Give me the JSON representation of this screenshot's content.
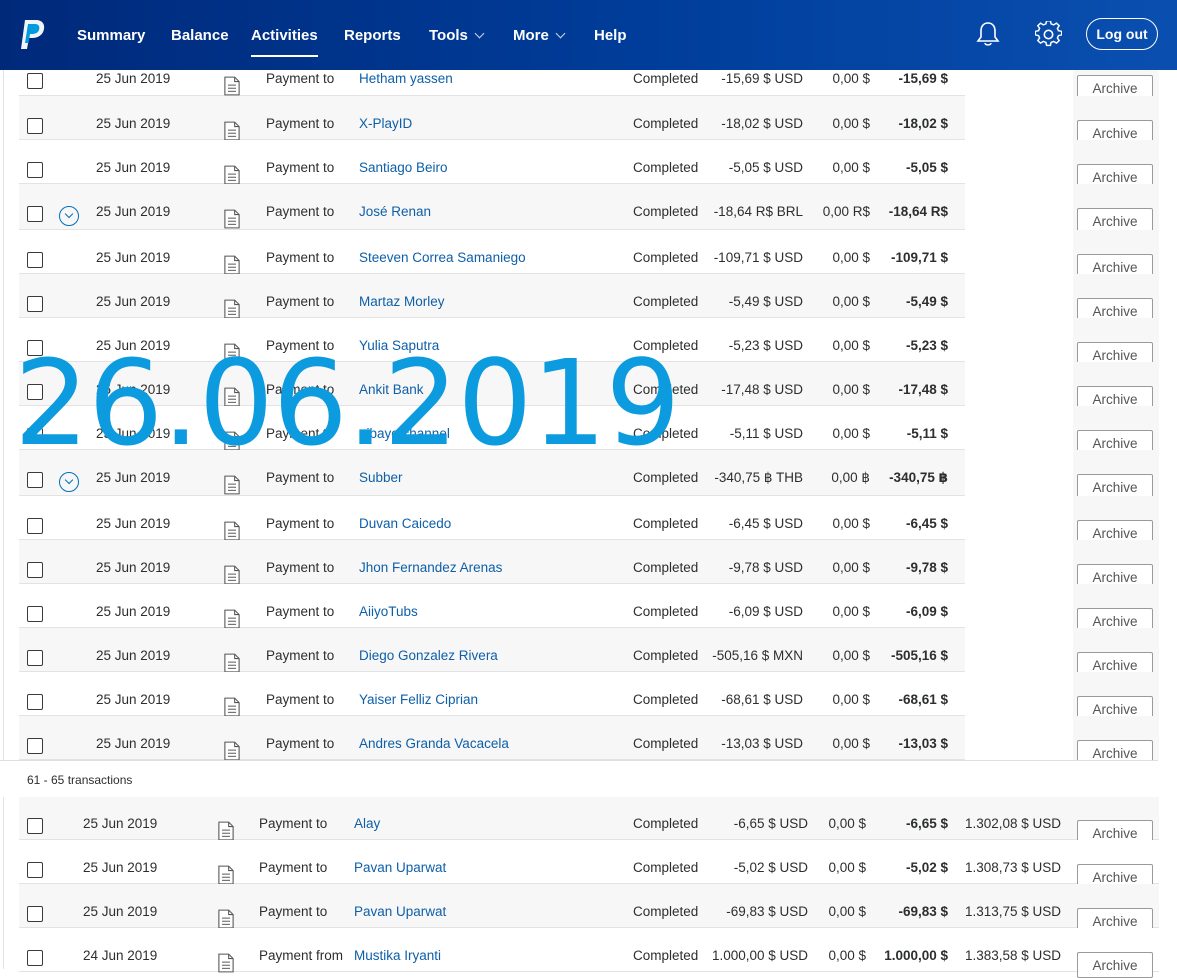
{
  "nav": {
    "items": [
      {
        "label": "Summary"
      },
      {
        "label": "Balance"
      },
      {
        "label": "Activities"
      },
      {
        "label": "Reports"
      },
      {
        "label": "Tools"
      },
      {
        "label": "More"
      },
      {
        "label": "Help"
      }
    ],
    "active": "Activities",
    "logout_label": "Log out"
  },
  "overlay_date": "26.06.2019",
  "archive_label": "Archive",
  "group_label": "61 - 65 transactions",
  "transactions_top": [
    {
      "date": "25 Jun 2019",
      "type": "Payment to",
      "name": "Hetham yassen",
      "status": "Completed",
      "gross": "-15,69 $ USD",
      "fee": "0,00 $",
      "net": "-15,69 $",
      "expandable": false
    },
    {
      "date": "25 Jun 2019",
      "type": "Payment to",
      "name": "X-PlayID",
      "status": "Completed",
      "gross": "-18,02 $ USD",
      "fee": "0,00 $",
      "net": "-18,02 $",
      "expandable": false
    },
    {
      "date": "25 Jun 2019",
      "type": "Payment to",
      "name": "Santiago Beiro",
      "status": "Completed",
      "gross": "-5,05 $ USD",
      "fee": "0,00 $",
      "net": "-5,05 $",
      "expandable": false
    },
    {
      "date": "25 Jun 2019",
      "type": "Payment to",
      "name": "José Renan",
      "status": "Completed",
      "gross": "-18,64 R$ BRL",
      "fee": "0,00 R$",
      "net": "-18,64 R$",
      "expandable": true
    },
    {
      "date": "25 Jun 2019",
      "type": "Payment to",
      "name": "Steeven Correa Samaniego",
      "status": "Completed",
      "gross": "-109,71 $ USD",
      "fee": "0,00 $",
      "net": "-109,71 $",
      "expandable": false
    },
    {
      "date": "25 Jun 2019",
      "type": "Payment to",
      "name": "Martaz Morley",
      "status": "Completed",
      "gross": "-5,49 $ USD",
      "fee": "0,00 $",
      "net": "-5,49 $",
      "expandable": false
    },
    {
      "date": "25 Jun 2019",
      "type": "Payment to",
      "name": "Yulia Saputra",
      "status": "Completed",
      "gross": "-5,23 $ USD",
      "fee": "0,00 $",
      "net": "-5,23 $",
      "expandable": false
    },
    {
      "date": "25 Jun 2019",
      "type": "Payment to",
      "name": "Ankit Bank",
      "status": "Completed",
      "gross": "-17,48 $ USD",
      "fee": "0,00 $",
      "net": "-17,48 $",
      "expandable": false
    },
    {
      "date": "25 Jun 2019",
      "type": "Payment to",
      "name": "aibaye channel",
      "status": "Completed",
      "gross": "-5,11 $ USD",
      "fee": "0,00 $",
      "net": "-5,11 $",
      "expandable": false
    },
    {
      "date": "25 Jun 2019",
      "type": "Payment to",
      "name": "Subber",
      "status": "Completed",
      "gross": "-340,75 ฿ THB",
      "fee": "0,00 ฿",
      "net": "-340,75 ฿",
      "expandable": true
    },
    {
      "date": "25 Jun 2019",
      "type": "Payment to",
      "name": "Duvan Caicedo",
      "status": "Completed",
      "gross": "-6,45 $ USD",
      "fee": "0,00 $",
      "net": "-6,45 $",
      "expandable": false
    },
    {
      "date": "25 Jun 2019",
      "type": "Payment to",
      "name": "Jhon Fernandez Arenas",
      "status": "Completed",
      "gross": "-9,78 $ USD",
      "fee": "0,00 $",
      "net": "-9,78 $",
      "expandable": false
    },
    {
      "date": "25 Jun 2019",
      "type": "Payment to",
      "name": "AiiyoTubs",
      "status": "Completed",
      "gross": "-6,09 $ USD",
      "fee": "0,00 $",
      "net": "-6,09 $",
      "expandable": false
    },
    {
      "date": "25 Jun 2019",
      "type": "Payment to",
      "name": "Diego Gonzalez Rivera",
      "status": "Completed",
      "gross": "-505,16 $ MXN",
      "fee": "0,00 $",
      "net": "-505,16 $",
      "expandable": false
    },
    {
      "date": "25 Jun 2019",
      "type": "Payment to",
      "name": "Yaiser Felliz Ciprian",
      "status": "Completed",
      "gross": "-68,61 $ USD",
      "fee": "0,00 $",
      "net": "-68,61 $",
      "expandable": false
    },
    {
      "date": "25 Jun 2019",
      "type": "Payment to",
      "name": "Andres Granda Vacacela",
      "status": "Completed",
      "gross": "-13,03 $ USD",
      "fee": "0,00 $",
      "net": "-13,03 $",
      "expandable": false
    }
  ],
  "transactions_bottom": [
    {
      "date": "25 Jun 2019",
      "type": "Payment to",
      "name": "Alay",
      "status": "Completed",
      "gross": "-6,65 $ USD",
      "fee": "0,00 $",
      "net": "-6,65 $",
      "balance": "1.302,08 $ USD"
    },
    {
      "date": "25 Jun 2019",
      "type": "Payment to",
      "name": "Pavan Uparwat",
      "status": "Completed",
      "gross": "-5,02 $ USD",
      "fee": "0,00 $",
      "net": "-5,02 $",
      "balance": "1.308,73 $ USD"
    },
    {
      "date": "25 Jun 2019",
      "type": "Payment to",
      "name": "Pavan Uparwat",
      "status": "Completed",
      "gross": "-69,83 $ USD",
      "fee": "0,00 $",
      "net": "-69,83 $",
      "balance": "1.313,75 $ USD"
    },
    {
      "date": "24 Jun 2019",
      "type": "Payment from",
      "name": "Mustika Iryanti",
      "status": "Completed",
      "gross": "1.000,00 $ USD",
      "fee": "0,00 $",
      "net": "1.000,00 $",
      "balance": "1.383,58 $ USD"
    }
  ]
}
